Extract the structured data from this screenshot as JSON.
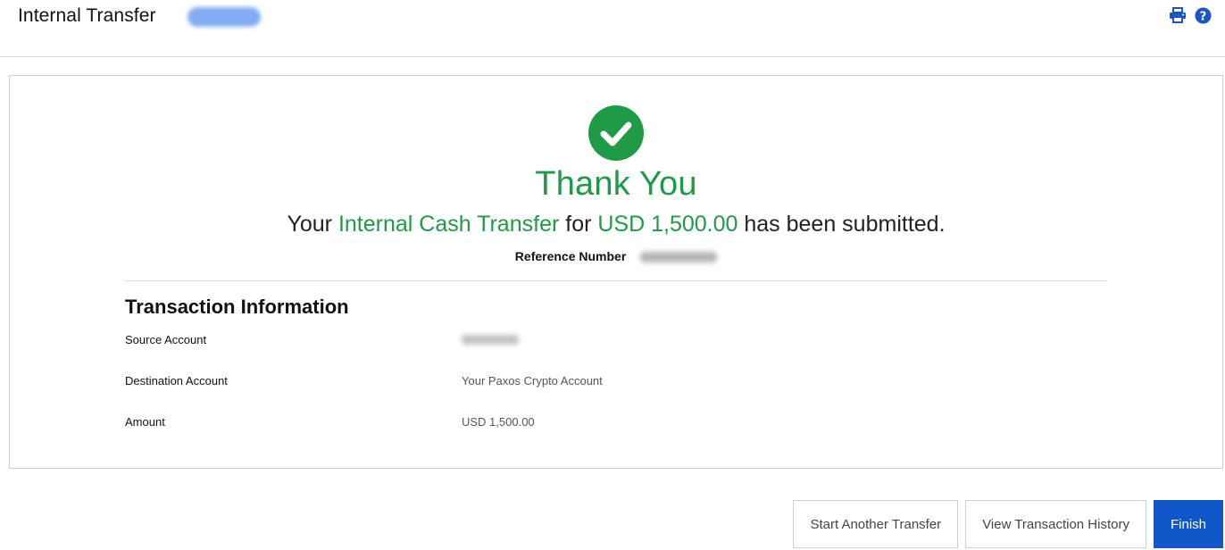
{
  "header": {
    "title": "Internal Transfer",
    "icons": {
      "print": "print-icon",
      "help": "help-icon"
    }
  },
  "confirmation": {
    "icon": "check-circle-icon",
    "heading": "Thank You",
    "message_prefix": "Your ",
    "transfer_type": "Internal Cash Transfer",
    "message_for": " for ",
    "amount": "USD 1,500.00",
    "message_suffix": " has been submitted.",
    "reference_label": "Reference Number"
  },
  "transaction": {
    "title": "Transaction Information",
    "rows": [
      {
        "label": "Source Account",
        "value": ""
      },
      {
        "label": "Destination Account",
        "value": "Your Paxos Crypto Account"
      },
      {
        "label": "Amount",
        "value": "USD 1,500.00"
      }
    ]
  },
  "actions": {
    "start_another": "Start Another Transfer",
    "view_history": "View Transaction History",
    "finish": "Finish"
  },
  "colors": {
    "success": "#1f9a45",
    "primary": "#1257c9",
    "icon_blue": "#1a56c4"
  }
}
